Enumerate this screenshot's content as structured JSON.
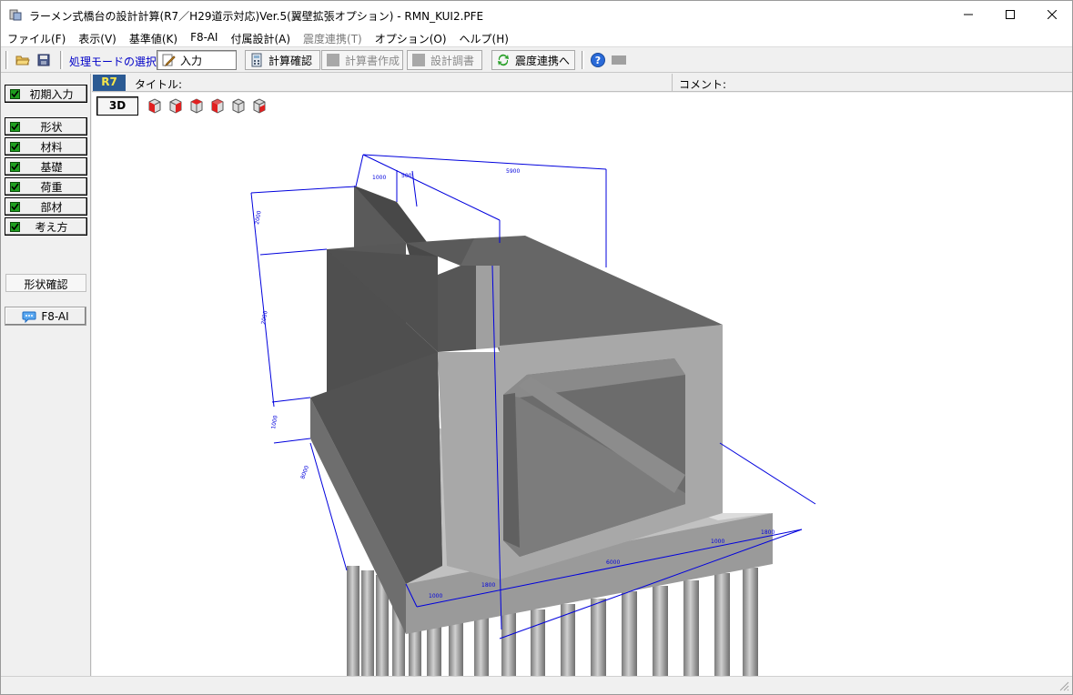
{
  "window": {
    "title": "ラーメン式橋台の設計計算(R7／H29道示対応)Ver.5(翼壁拡張オプション) - RMN_KUI2.PFE"
  },
  "menu": [
    {
      "label": "ファイル(F)",
      "enabled": true
    },
    {
      "label": "表示(V)",
      "enabled": true
    },
    {
      "label": "基準値(K)",
      "enabled": true
    },
    {
      "label": "F8-AI",
      "enabled": true
    },
    {
      "label": "付属設計(A)",
      "enabled": true
    },
    {
      "label": "震度連携(T)",
      "enabled": false
    },
    {
      "label": "オプション(O)",
      "enabled": true
    },
    {
      "label": "ヘルプ(H)",
      "enabled": true
    }
  ],
  "toolbar": {
    "mode_label": "処理モードの選択",
    "input_label": "入力",
    "calc_check_label": "計算確認",
    "report_label": "計算書作成",
    "design_sheet_label": "設計調書",
    "seismic_link_label": "震度連携へ"
  },
  "sidebar": {
    "initial_input": "初期入力",
    "items": [
      "形状",
      "材料",
      "基礎",
      "荷重",
      "部材",
      "考え方"
    ],
    "shape_confirm": "形状確認",
    "f8ai": "F8-AI"
  },
  "infobar": {
    "standard_badge": "R7",
    "title_label": "タイトル:",
    "comment_label": "コメント:"
  },
  "view": {
    "mode_button": "3D",
    "cube_views": [
      "front-view-icon",
      "side-view-icon",
      "right-view-icon",
      "left-view-icon",
      "top-view-icon",
      "back-view-icon"
    ]
  },
  "dimensions": {
    "top_1": "1000",
    "top_2": "500",
    "top_3": "5900",
    "left_1": "2000",
    "left_2": "2000",
    "left_3": "1000",
    "base_1": "1000",
    "base_2": "1800",
    "base_3": "6000",
    "base_4": "1000",
    "base_5": "1800",
    "depth": "8000"
  },
  "colors": {
    "badge_bg": "#2b5a93",
    "badge_text": "#f8e64a",
    "mode_label": "#0000c8",
    "dimension_line": "#0000dd"
  }
}
